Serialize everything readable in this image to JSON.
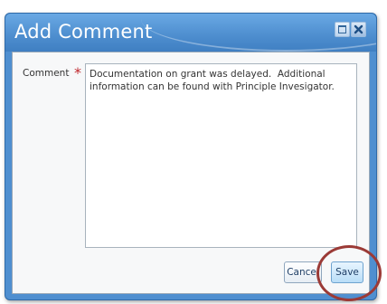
{
  "dialog": {
    "title": "Add Comment",
    "icons": {
      "maximize": "maximize-icon",
      "close": "close-icon"
    }
  },
  "form": {
    "comment_label": "Comment",
    "required_marker": "*",
    "comment_value": "Documentation on grant was delayed.  Additional information can be found with Principle Invesigator."
  },
  "buttons": {
    "cancel_label": "Cancel",
    "save_label": "Save"
  },
  "colors": {
    "title_bar": "#4f8fd0",
    "required": "#c0282d",
    "highlight": "#9b3a36"
  }
}
